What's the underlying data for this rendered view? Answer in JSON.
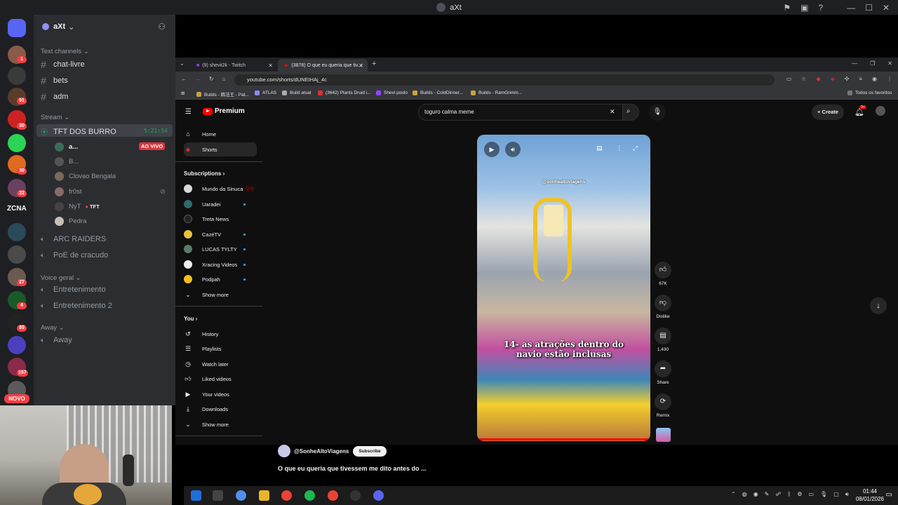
{
  "window_title": "aXt",
  "discord": {
    "server_name": "aXt",
    "rail_badges": [
      "1",
      "91",
      "30",
      "30",
      "22",
      "27",
      "4",
      "85",
      "157"
    ],
    "rail_label_zcna": "ZCNA",
    "novo_label": "NOVO",
    "categories": {
      "text": "Text channels",
      "stream": "Stream",
      "voice": "Voice geral",
      "away": "Away"
    },
    "text_channels": [
      "chat-livre",
      "bets",
      "adm"
    ],
    "stream_channel": {
      "name": "TFT DOS BURRO",
      "timer": "5:21:54"
    },
    "stream_users": [
      {
        "name": "a...",
        "live": "AO VIVO"
      },
      {
        "name": "B..."
      },
      {
        "name": "Clovao Bengala"
      },
      {
        "name": "fr0st"
      },
      {
        "name": "NyT",
        "tag": "TFT"
      },
      {
        "name": "Pedra"
      }
    ],
    "other_channels": [
      "ARC RAIDERS",
      "PoE de cracudo"
    ],
    "voice_channels": [
      "Entretenimento",
      "Entretenimento 2"
    ],
    "away_channels": [
      "Away"
    ]
  },
  "browser": {
    "tabs": [
      {
        "title": "(9) shevii2k - Twitch"
      },
      {
        "title": "(3878) O que eu queria que tiv..."
      }
    ],
    "url": "youtube.com/shorts/dUNEIHAj_4c",
    "bookmarks": [
      "Builds - 韩法王 - Pat...",
      "ATLAS",
      "Build atual",
      "(3642) Plants Druid i...",
      "Shevi poido",
      "Builds - ColdDinner...",
      "Builds - RamGrimm..."
    ],
    "all_bookmarks": "Todos os favoritos"
  },
  "youtube": {
    "logo": "Premium",
    "search_value": "toguro calma meme",
    "create_label": "Create",
    "notif_count": "9+",
    "nav": [
      {
        "label": "Home",
        "icon": "home-icon"
      },
      {
        "label": "Shorts",
        "icon": "shorts-icon"
      }
    ],
    "subscriptions_title": "Subscriptions",
    "subscriptions": [
      {
        "name": "Mundo da Sinuca",
        "color": "#d9d9d9"
      },
      {
        "name": "Uaradei",
        "color": "#2f6b6b"
      },
      {
        "name": "Treta News",
        "color": "#222222"
      },
      {
        "name": "CazéTV",
        "color": "#e8c23a"
      },
      {
        "name": "LUCAS TYLTY",
        "color": "#5a7a6a"
      },
      {
        "name": "Xracing Videos",
        "color": "#eeeeee"
      },
      {
        "name": "Podpah",
        "color": "#f0c020"
      }
    ],
    "show_more": "Show more",
    "you_title": "You",
    "you_items": [
      {
        "label": "History",
        "icon": "history-icon"
      },
      {
        "label": "Playlists",
        "icon": "playlists-icon"
      },
      {
        "label": "Watch later",
        "icon": "clock-icon"
      },
      {
        "label": "Liked videos",
        "icon": "thumbs-up-icon"
      },
      {
        "label": "Your videos",
        "icon": "video-icon"
      },
      {
        "label": "Downloads",
        "icon": "download-icon"
      }
    ],
    "short": {
      "handle_overlay": "@sonhealtoviagens",
      "caption_line1": "14- as atrações dentro do",
      "caption_line2": "navio estão inclusas",
      "channel": "@SonheAltoViagens",
      "subscribe": "Subscribe",
      "title": "O que eu queria que tivessem me dito antes do ...",
      "likes": "67K",
      "dislike": "Dislike",
      "comments": "1,430",
      "share": "Share",
      "remix": "Remix"
    }
  },
  "taskbar": {
    "time": "01:44",
    "date": "08/01/2026"
  }
}
